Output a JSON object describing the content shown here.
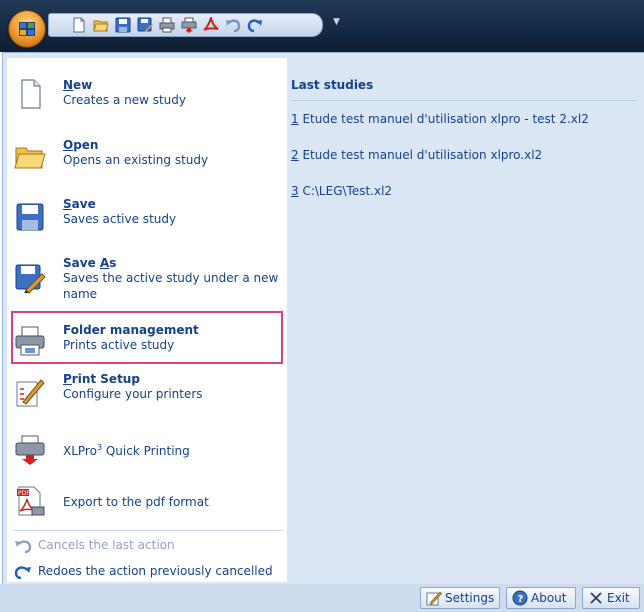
{
  "menu": {
    "items": [
      {
        "title": "New",
        "accel_letter": "N",
        "title_rest": "ew",
        "desc": "Creates a new study",
        "icon": "new-document-icon"
      },
      {
        "title": "Open",
        "accel_letter": "O",
        "title_rest": "pen",
        "desc": "Opens an existing study",
        "icon": "open-folder-icon"
      },
      {
        "title": "Save",
        "accel_letter": "S",
        "title_rest": "ave",
        "desc": "Saves active study",
        "icon": "save-disk-icon"
      },
      {
        "title": "Save As",
        "title_pre": "Save ",
        "accel_letter": "A",
        "title_rest": "s",
        "desc": "Saves the active study under a new name",
        "icon": "save-as-icon"
      },
      {
        "title": "Folder management",
        "desc": "Prints active study",
        "icon": "printer-icon"
      },
      {
        "title": "Print Setup",
        "accel_letter": "P",
        "title_rest": "rint Setup",
        "desc": "Configure your printers",
        "icon": "print-setup-icon"
      },
      {
        "label_pre": "XLPro",
        "label_sup": "3",
        "label_post": " Quick Printing",
        "icon": "quick-print-icon"
      },
      {
        "label": "Export to the pdf  format",
        "icon": "pdf-export-icon"
      }
    ],
    "undo_label": "Cancels the last action",
    "redo_label": "Redoes the action previously cancelled"
  },
  "last_studies": {
    "header": "Last studies",
    "items": [
      {
        "index": "1",
        "name": " Etude test manuel d'utilisation xlpro - test 2.xl2"
      },
      {
        "index": "2",
        "name": " Etude test manuel d'utilisation xlpro.xl2"
      },
      {
        "index": "3",
        "name": " C:\\LEG\\Test.xl2"
      }
    ]
  },
  "footer": {
    "settings_label": "Settings",
    "about_label": "About",
    "exit_label": "Exit"
  },
  "colors": {
    "text": "#15428b",
    "highlight_border": "#d9408c",
    "pane_bg": "#dbe6f5"
  }
}
